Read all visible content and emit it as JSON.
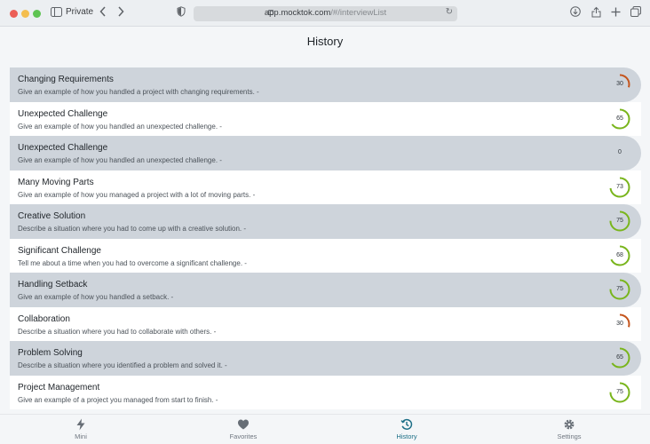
{
  "browser": {
    "private_label": "Private",
    "url_domain": "app.mocktok.com",
    "url_path": "/#/interviewList"
  },
  "header": {
    "title": "History"
  },
  "colors": {
    "shaded_row": "#ced4db",
    "low_score": "#c4541c",
    "good_score": "#79b51c",
    "active_nav": "#1b6e86"
  },
  "items": [
    {
      "title": "Changing Requirements",
      "description": "Give an example of how you handled a project with changing requirements. -",
      "score": 30
    },
    {
      "title": "Unexpected Challenge",
      "description": "Give an example of how you handled an unexpected challenge. -",
      "score": 65
    },
    {
      "title": "Unexpected Challenge",
      "description": "Give an example of how you handled an unexpected challenge. -",
      "score": 0
    },
    {
      "title": "Many Moving Parts",
      "description": "Give an example of how you managed a project with a lot of moving parts. -",
      "score": 73
    },
    {
      "title": "Creative Solution",
      "description": "Describe a situation where you had to come up with a creative solution. -",
      "score": 75
    },
    {
      "title": "Significant Challenge",
      "description": "Tell me about a time when you had to overcome a significant challenge. -",
      "score": 68
    },
    {
      "title": "Handling Setback",
      "description": "Give an example of how you handled a setback. -",
      "score": 75
    },
    {
      "title": "Collaboration",
      "description": "Describe a situation where you had to collaborate with others. -",
      "score": 30
    },
    {
      "title": "Problem Solving",
      "description": "Describe a situation where you identified a problem and solved it. -",
      "score": 65
    },
    {
      "title": "Project Management",
      "description": "Give an example of a project you managed from start to finish. -",
      "score": 75
    }
  ],
  "nav": [
    {
      "label": "Mini",
      "icon": "bolt-icon",
      "active": false
    },
    {
      "label": "Favorites",
      "icon": "heart-icon",
      "active": false
    },
    {
      "label": "History",
      "icon": "history-icon",
      "active": true
    },
    {
      "label": "Settings",
      "icon": "gear-icon",
      "active": false
    }
  ]
}
